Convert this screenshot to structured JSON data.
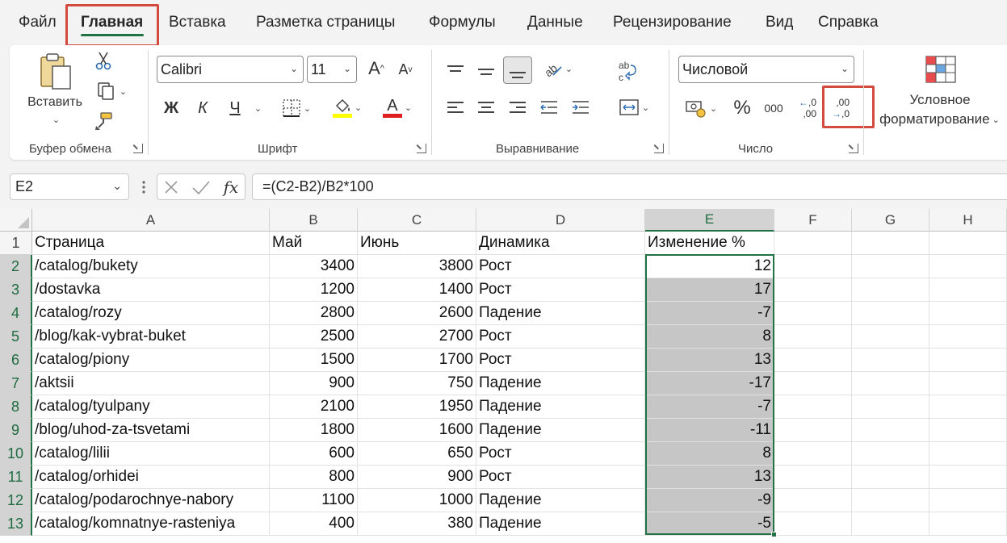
{
  "menu": {
    "tabs": [
      "Файл",
      "Главная",
      "Вставка",
      "Разметка страницы",
      "Формулы",
      "Данные",
      "Рецензирование",
      "Вид",
      "Справка"
    ],
    "active_tab": "Главная"
  },
  "ribbon": {
    "clipboard": {
      "paste_label": "Вставить",
      "group_label": "Буфер обмена"
    },
    "font": {
      "font_name": "Calibri",
      "font_size": "11",
      "bold": "Ж",
      "italic": "К",
      "underline": "Ч",
      "grow": "A",
      "shrink": "A",
      "font_color_letter": "A",
      "group_label": "Шрифт"
    },
    "alignment": {
      "group_label": "Выравнивание"
    },
    "number": {
      "format": "Числовой",
      "percent": "%",
      "thousands": "000",
      "dec_inc_top": ",0",
      "dec_inc_bottom": ",00",
      "dec_dec_top": ",00",
      "dec_dec_bottom": ",0",
      "group_label": "Число"
    },
    "styles": {
      "cond_format_line1": "Условное",
      "cond_format_line2": "форматирование"
    },
    "colors": {
      "highlight": "#ffff00",
      "font_color": "#e02020",
      "accent": "#217346",
      "annotation": "#d24b3e"
    }
  },
  "formula_bar": {
    "name_box": "E2",
    "fx": "fx",
    "formula": "=(C2-B2)/B2*100"
  },
  "sheet": {
    "columns": [
      "A",
      "B",
      "C",
      "D",
      "E",
      "F",
      "G",
      "H"
    ],
    "selected_column": "E",
    "rows": [
      [
        "Страница",
        "Май",
        "Июнь",
        "Динамика",
        "Изменение %"
      ],
      [
        "/catalog/bukety",
        "3400",
        "3800",
        "Рост",
        "12"
      ],
      [
        "/dostavka",
        "1200",
        "1400",
        "Рост",
        "17"
      ],
      [
        "/catalog/rozy",
        "2800",
        "2600",
        "Падение",
        "-7"
      ],
      [
        "/blog/kak-vybrat-buket",
        "2500",
        "2700",
        "Рост",
        "8"
      ],
      [
        "/catalog/piony",
        "1500",
        "1700",
        "Рост",
        "13"
      ],
      [
        "/aktsii",
        "900",
        "750",
        "Падение",
        "-17"
      ],
      [
        "/catalog/tyulpany",
        "2100",
        "1950",
        "Падение",
        "-7"
      ],
      [
        "/blog/uhod-za-tsvetami",
        "1800",
        "1600",
        "Падение",
        "-11"
      ],
      [
        "/catalog/lilii",
        "600",
        "650",
        "Рост",
        "8"
      ],
      [
        "/catalog/orhidei",
        "800",
        "900",
        "Рост",
        "13"
      ],
      [
        "/catalog/podarochnye-nabory",
        "1100",
        "1000",
        "Падение",
        "-9"
      ],
      [
        "/catalog/komnatnye-rasteniya",
        "400",
        "380",
        "Падение",
        "-5"
      ]
    ]
  }
}
